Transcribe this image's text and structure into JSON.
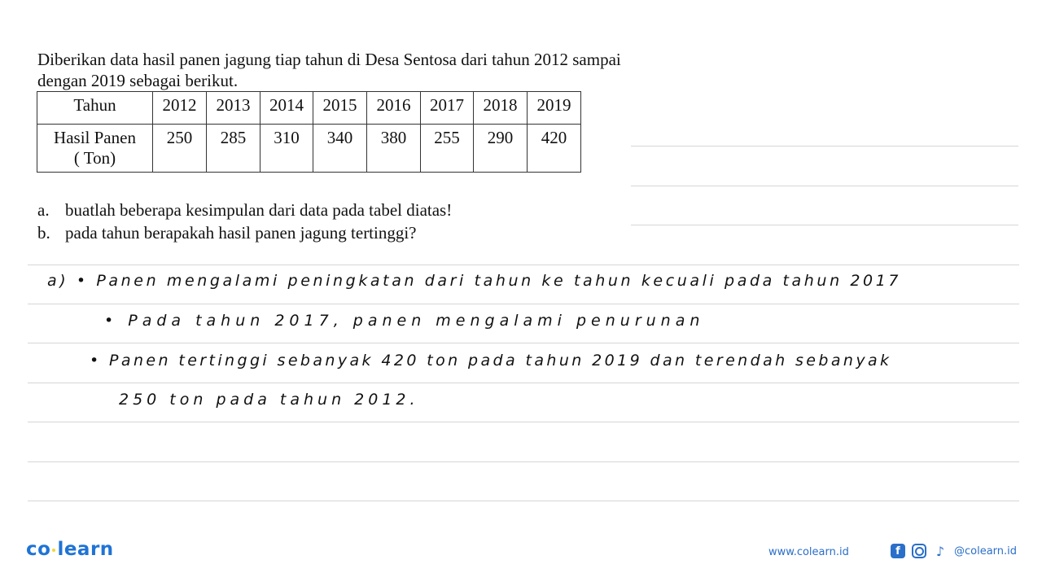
{
  "problem": {
    "intro": "Diberikan data hasil panen jagung tiap tahun di Desa Sentosa dari tahun 2012 sampai dengan 2019 sebagai berikut.",
    "table": {
      "row_header_year": "Tahun",
      "row_header_yield_line1": "Hasil Panen",
      "row_header_yield_line2": "( Ton)",
      "years": [
        "2012",
        "2013",
        "2014",
        "2015",
        "2016",
        "2017",
        "2018",
        "2019"
      ],
      "yields": [
        "250",
        "285",
        "310",
        "340",
        "380",
        "255",
        "290",
        "420"
      ]
    },
    "questions": [
      {
        "label": "a.",
        "text": "buatlah beberapa kesimpulan dari data pada tabel diatas!"
      },
      {
        "label": "b.",
        "text": "pada tahun berapakah hasil panen jagung tertinggi?"
      }
    ]
  },
  "handwritten_answer": {
    "lines": [
      "a) • Panen mengalami peningkatan dari tahun ke tahun kecuali pada tahun 2017",
      "• Pada tahun 2017, panen mengalami penurunan",
      "• Panen tertinggi sebanyak 420 ton pada tahun 2019 dan terendah sebanyak",
      "250 ton pada tahun 2012."
    ]
  },
  "footer": {
    "logo_left": "co",
    "logo_right": "learn",
    "website": "www.colearn.id",
    "social_handle": "@colearn.id",
    "icons": [
      "facebook-icon",
      "instagram-icon",
      "tiktok-icon"
    ],
    "brand_color": "#1f73d6"
  }
}
